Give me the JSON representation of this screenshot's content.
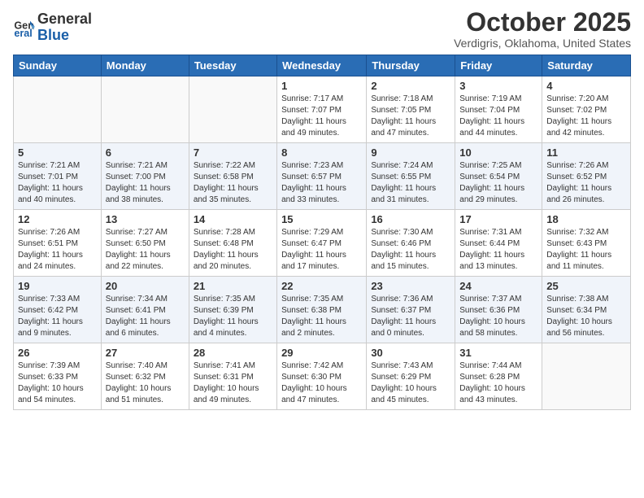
{
  "header": {
    "logo_line1": "General",
    "logo_line2": "Blue",
    "title": "October 2025",
    "subtitle": "Verdigris, Oklahoma, United States"
  },
  "weekdays": [
    "Sunday",
    "Monday",
    "Tuesday",
    "Wednesday",
    "Thursday",
    "Friday",
    "Saturday"
  ],
  "weeks": [
    [
      {
        "day": "",
        "info": ""
      },
      {
        "day": "",
        "info": ""
      },
      {
        "day": "",
        "info": ""
      },
      {
        "day": "1",
        "info": "Sunrise: 7:17 AM\nSunset: 7:07 PM\nDaylight: 11 hours\nand 49 minutes."
      },
      {
        "day": "2",
        "info": "Sunrise: 7:18 AM\nSunset: 7:05 PM\nDaylight: 11 hours\nand 47 minutes."
      },
      {
        "day": "3",
        "info": "Sunrise: 7:19 AM\nSunset: 7:04 PM\nDaylight: 11 hours\nand 44 minutes."
      },
      {
        "day": "4",
        "info": "Sunrise: 7:20 AM\nSunset: 7:02 PM\nDaylight: 11 hours\nand 42 minutes."
      }
    ],
    [
      {
        "day": "5",
        "info": "Sunrise: 7:21 AM\nSunset: 7:01 PM\nDaylight: 11 hours\nand 40 minutes."
      },
      {
        "day": "6",
        "info": "Sunrise: 7:21 AM\nSunset: 7:00 PM\nDaylight: 11 hours\nand 38 minutes."
      },
      {
        "day": "7",
        "info": "Sunrise: 7:22 AM\nSunset: 6:58 PM\nDaylight: 11 hours\nand 35 minutes."
      },
      {
        "day": "8",
        "info": "Sunrise: 7:23 AM\nSunset: 6:57 PM\nDaylight: 11 hours\nand 33 minutes."
      },
      {
        "day": "9",
        "info": "Sunrise: 7:24 AM\nSunset: 6:55 PM\nDaylight: 11 hours\nand 31 minutes."
      },
      {
        "day": "10",
        "info": "Sunrise: 7:25 AM\nSunset: 6:54 PM\nDaylight: 11 hours\nand 29 minutes."
      },
      {
        "day": "11",
        "info": "Sunrise: 7:26 AM\nSunset: 6:52 PM\nDaylight: 11 hours\nand 26 minutes."
      }
    ],
    [
      {
        "day": "12",
        "info": "Sunrise: 7:26 AM\nSunset: 6:51 PM\nDaylight: 11 hours\nand 24 minutes."
      },
      {
        "day": "13",
        "info": "Sunrise: 7:27 AM\nSunset: 6:50 PM\nDaylight: 11 hours\nand 22 minutes."
      },
      {
        "day": "14",
        "info": "Sunrise: 7:28 AM\nSunset: 6:48 PM\nDaylight: 11 hours\nand 20 minutes."
      },
      {
        "day": "15",
        "info": "Sunrise: 7:29 AM\nSunset: 6:47 PM\nDaylight: 11 hours\nand 17 minutes."
      },
      {
        "day": "16",
        "info": "Sunrise: 7:30 AM\nSunset: 6:46 PM\nDaylight: 11 hours\nand 15 minutes."
      },
      {
        "day": "17",
        "info": "Sunrise: 7:31 AM\nSunset: 6:44 PM\nDaylight: 11 hours\nand 13 minutes."
      },
      {
        "day": "18",
        "info": "Sunrise: 7:32 AM\nSunset: 6:43 PM\nDaylight: 11 hours\nand 11 minutes."
      }
    ],
    [
      {
        "day": "19",
        "info": "Sunrise: 7:33 AM\nSunset: 6:42 PM\nDaylight: 11 hours\nand 9 minutes."
      },
      {
        "day": "20",
        "info": "Sunrise: 7:34 AM\nSunset: 6:41 PM\nDaylight: 11 hours\nand 6 minutes."
      },
      {
        "day": "21",
        "info": "Sunrise: 7:35 AM\nSunset: 6:39 PM\nDaylight: 11 hours\nand 4 minutes."
      },
      {
        "day": "22",
        "info": "Sunrise: 7:35 AM\nSunset: 6:38 PM\nDaylight: 11 hours\nand 2 minutes."
      },
      {
        "day": "23",
        "info": "Sunrise: 7:36 AM\nSunset: 6:37 PM\nDaylight: 11 hours\nand 0 minutes."
      },
      {
        "day": "24",
        "info": "Sunrise: 7:37 AM\nSunset: 6:36 PM\nDaylight: 10 hours\nand 58 minutes."
      },
      {
        "day": "25",
        "info": "Sunrise: 7:38 AM\nSunset: 6:34 PM\nDaylight: 10 hours\nand 56 minutes."
      }
    ],
    [
      {
        "day": "26",
        "info": "Sunrise: 7:39 AM\nSunset: 6:33 PM\nDaylight: 10 hours\nand 54 minutes."
      },
      {
        "day": "27",
        "info": "Sunrise: 7:40 AM\nSunset: 6:32 PM\nDaylight: 10 hours\nand 51 minutes."
      },
      {
        "day": "28",
        "info": "Sunrise: 7:41 AM\nSunset: 6:31 PM\nDaylight: 10 hours\nand 49 minutes."
      },
      {
        "day": "29",
        "info": "Sunrise: 7:42 AM\nSunset: 6:30 PM\nDaylight: 10 hours\nand 47 minutes."
      },
      {
        "day": "30",
        "info": "Sunrise: 7:43 AM\nSunset: 6:29 PM\nDaylight: 10 hours\nand 45 minutes."
      },
      {
        "day": "31",
        "info": "Sunrise: 7:44 AM\nSunset: 6:28 PM\nDaylight: 10 hours\nand 43 minutes."
      },
      {
        "day": "",
        "info": ""
      }
    ]
  ]
}
